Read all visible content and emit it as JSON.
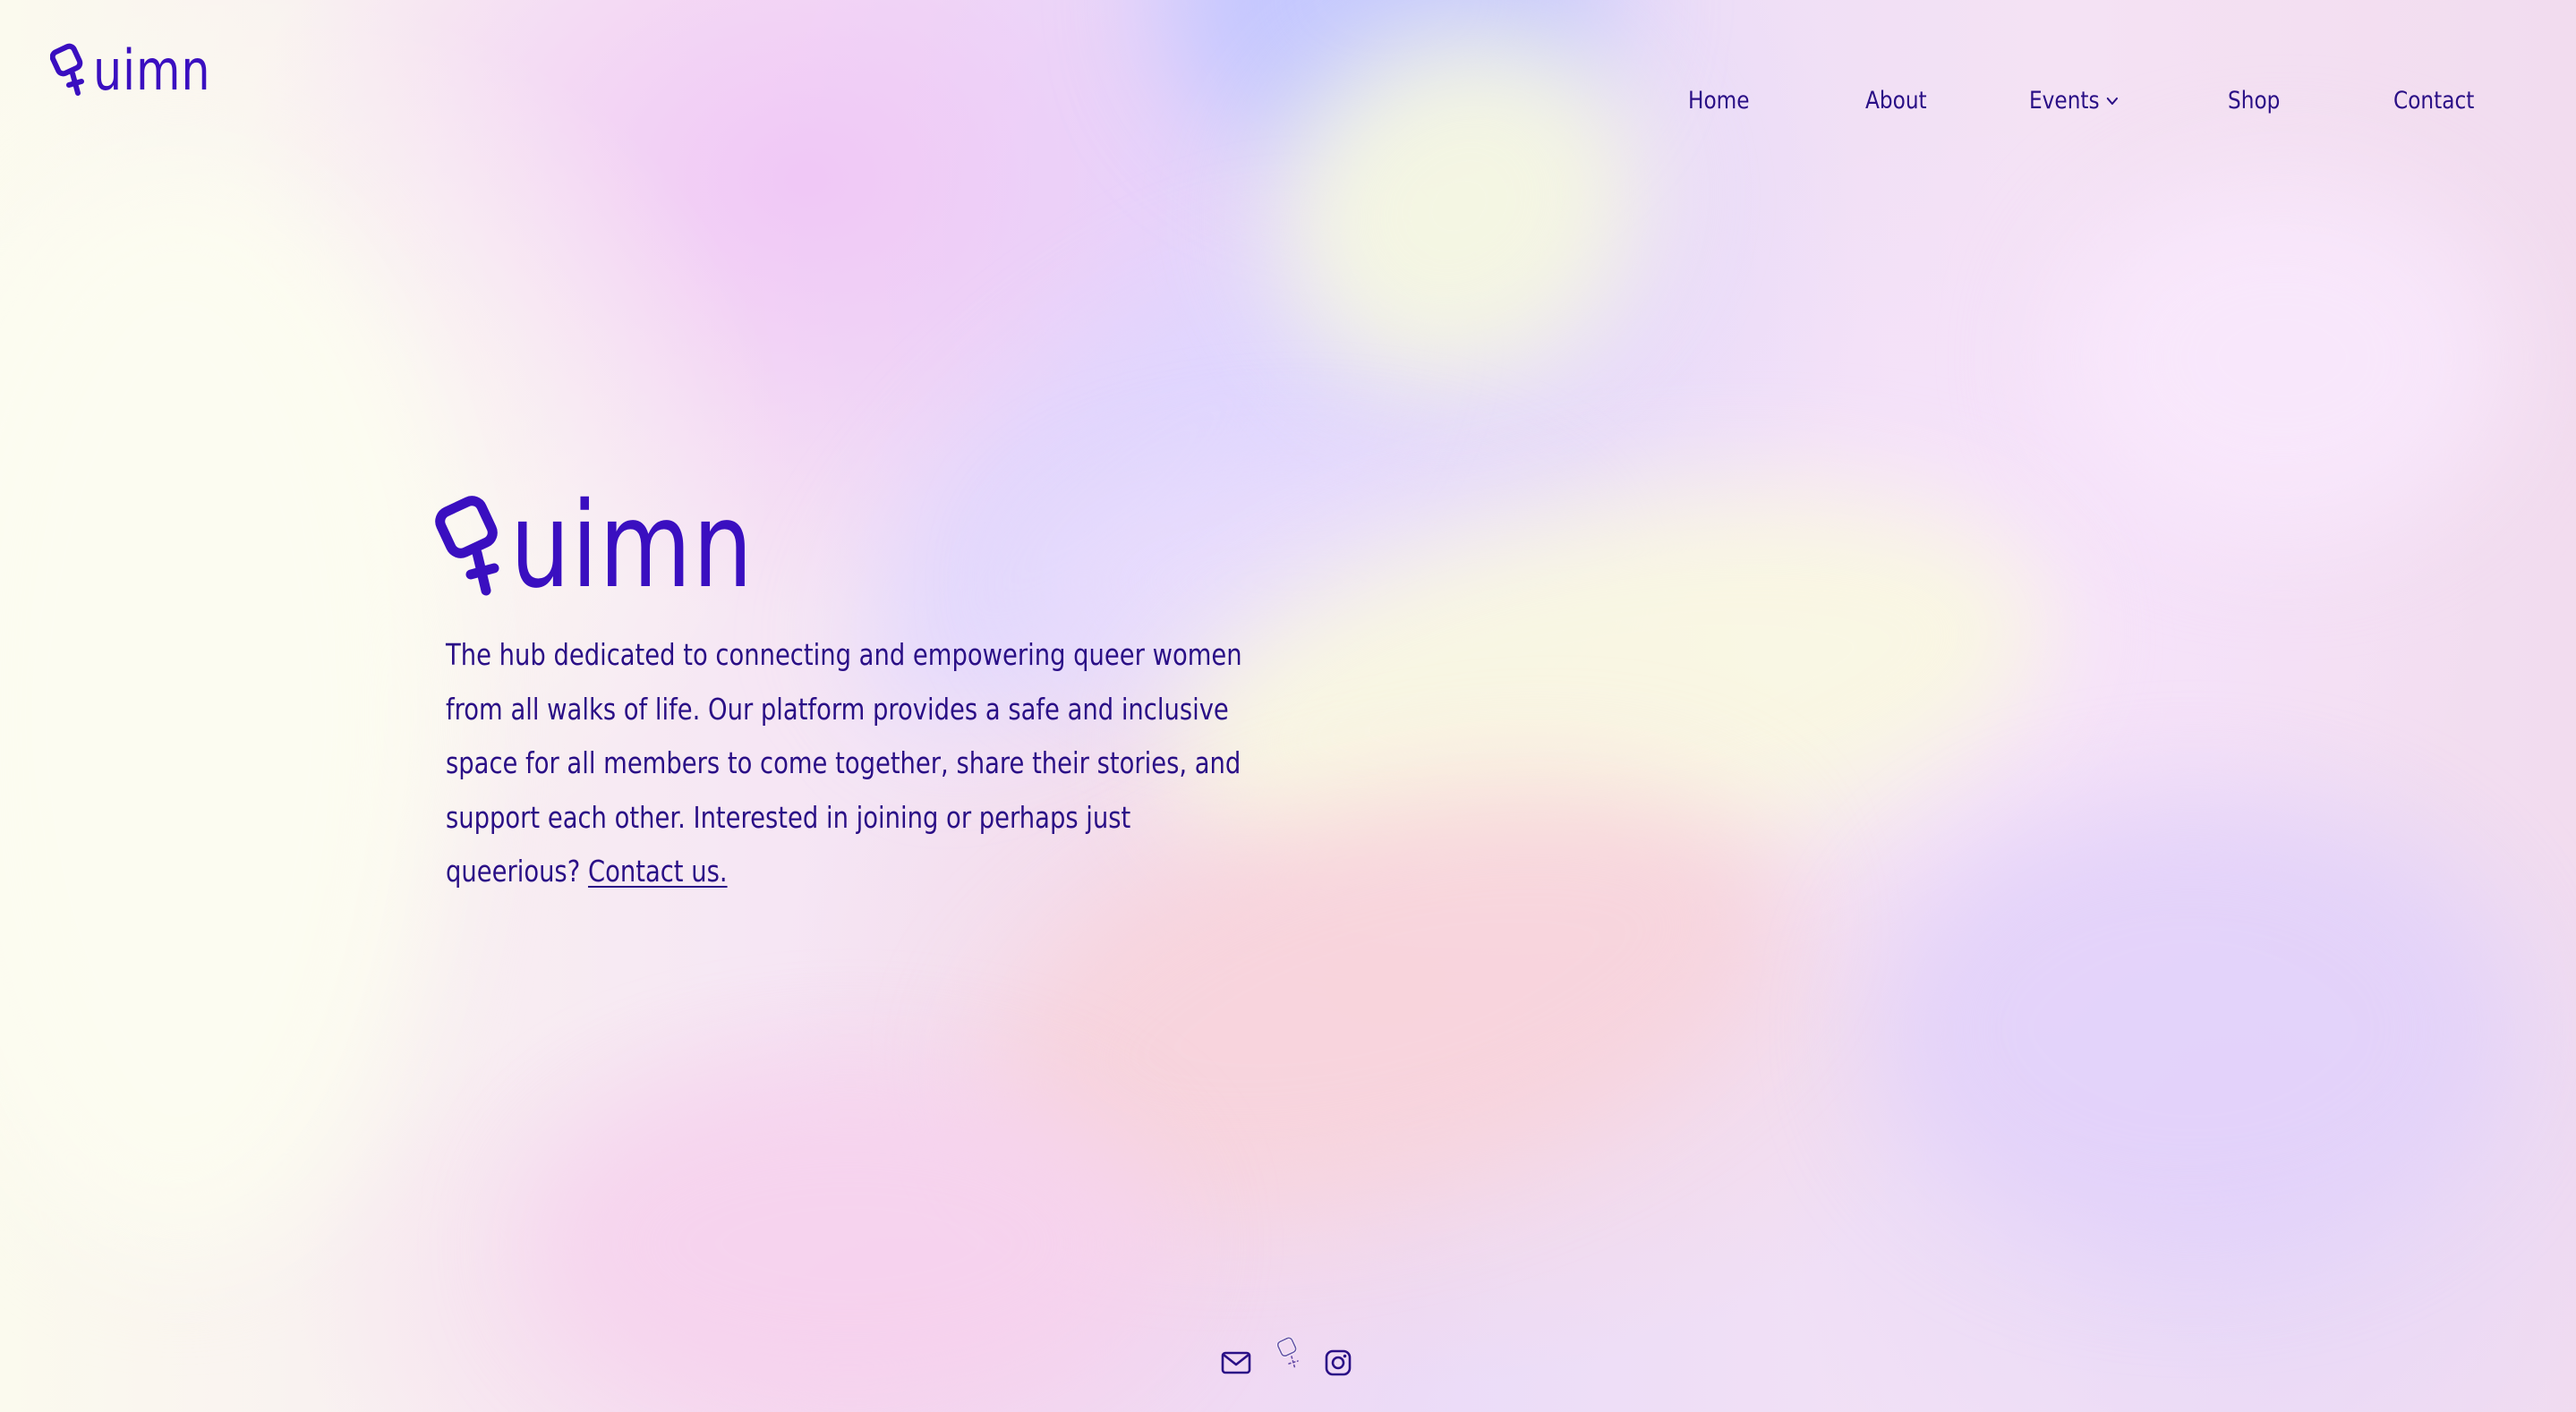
{
  "brand": {
    "logo_text": "uimn",
    "logo_icon": "venus-q-icon"
  },
  "nav": {
    "items": [
      {
        "label": "Home"
      },
      {
        "label": "About"
      },
      {
        "label": "Events",
        "icon": "chevron-down-icon"
      },
      {
        "label": "Shop"
      },
      {
        "label": "Contact"
      }
    ]
  },
  "hero": {
    "title_text": "uimn",
    "title_icon": "venus-q-icon",
    "description": "The hub dedicated to connecting and empowering queer women from all walks of life. Our platform provides a safe and inclusive space for all members to come together, share their stories, and support each other. Interested in joining or perhaps just queerious?",
    "cta_link": "Contact us."
  },
  "footer": {
    "icons": [
      "mail-icon",
      "venus-q-icon",
      "instagram-icon"
    ]
  },
  "colors": {
    "brand_purple": "#3a0fc0",
    "text_purple": "#2a0f86",
    "background_base": "#fbfaf0"
  }
}
